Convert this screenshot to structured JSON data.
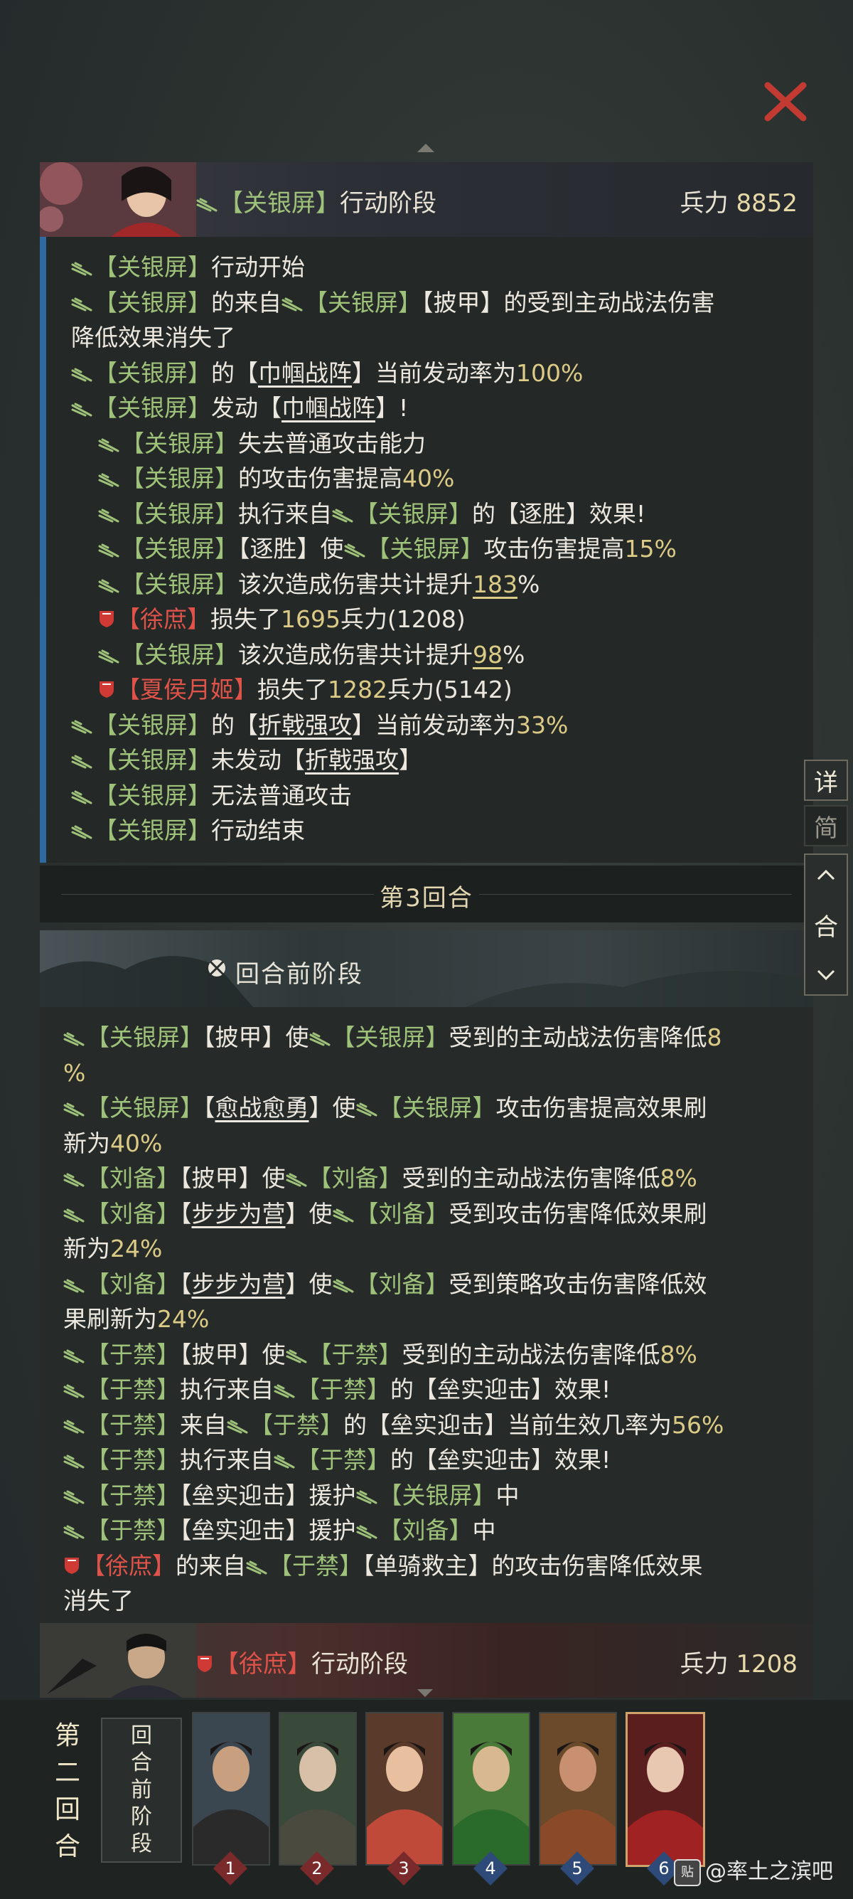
{
  "colors": {
    "name_green": "#9fc27a",
    "name_red": "#e0534a",
    "highlight": "#dccb86",
    "log_bar_blue": "#2c6aa0",
    "close_red": "#c23a32"
  },
  "icons": {
    "ally": "green-slash-icon",
    "enemy": "red-shield-icon"
  },
  "action_header": {
    "name": "关银屏",
    "phase": "行动阶段",
    "troops_label": "兵力",
    "troops_value": "8852"
  },
  "round_separator": "第3回合",
  "pre_round_banner": "回合前阶段",
  "bottom_header": {
    "name": "徐庶",
    "phase": "行动阶段",
    "troops_label": "兵力",
    "troops_value": "1208"
  },
  "side_panel": {
    "detail": "详",
    "simple": "简",
    "round": "合"
  },
  "round_label": [
    "第",
    "二",
    "回",
    "合"
  ],
  "pre_phase_card": [
    "回",
    "合",
    "前",
    "阶",
    "段"
  ],
  "heroes": [
    {
      "number": "1",
      "team": "enemy"
    },
    {
      "number": "2",
      "team": "enemy"
    },
    {
      "number": "3",
      "team": "enemy"
    },
    {
      "number": "4",
      "team": "ally"
    },
    {
      "number": "5",
      "team": "ally"
    },
    {
      "number": "6",
      "team": "ally"
    }
  ],
  "watermark": "@率土之滨吧",
  "watermark_badge": "贴",
  "log1": [
    {
      "indent": 0,
      "segs": [
        {
          "t": "ally"
        },
        {
          "n": "关银屏"
        },
        {
          "x": "行动开始"
        }
      ]
    },
    {
      "indent": 0,
      "segs": [
        {
          "t": "ally"
        },
        {
          "n": "关银屏"
        },
        {
          "x": "的来自"
        },
        {
          "t": "ally"
        },
        {
          "n": "关银屏"
        },
        {
          "x": "【披甲】的受到主动战法伤害"
        }
      ]
    },
    {
      "indent": 0,
      "segs": [
        {
          "x": "降低效果消失了"
        }
      ]
    },
    {
      "indent": 0,
      "segs": [
        {
          "t": "ally"
        },
        {
          "n": "关银屏"
        },
        {
          "x": "的【"
        },
        {
          "s": "巾帼战阵"
        },
        {
          "x": "】当前发动率为"
        },
        {
          "h": "100%"
        }
      ]
    },
    {
      "indent": 0,
      "segs": [
        {
          "t": "ally"
        },
        {
          "n": "关银屏"
        },
        {
          "x": "发动【"
        },
        {
          "s": "巾帼战阵"
        },
        {
          "x": "】!"
        }
      ]
    },
    {
      "indent": 1,
      "segs": [
        {
          "t": "ally"
        },
        {
          "n": "关银屏"
        },
        {
          "x": "失去普通攻击能力"
        }
      ]
    },
    {
      "indent": 1,
      "segs": [
        {
          "t": "ally"
        },
        {
          "n": "关银屏"
        },
        {
          "x": "的攻击伤害提高"
        },
        {
          "h": "40%"
        }
      ]
    },
    {
      "indent": 1,
      "segs": [
        {
          "t": "ally"
        },
        {
          "n": "关银屏"
        },
        {
          "x": "执行来自"
        },
        {
          "t": "ally"
        },
        {
          "n": "关银屏"
        },
        {
          "x": "的【逐胜】效果!"
        }
      ]
    },
    {
      "indent": 1,
      "segs": [
        {
          "t": "ally"
        },
        {
          "n": "关银屏"
        },
        {
          "x": "【逐胜】使"
        },
        {
          "t": "ally"
        },
        {
          "n": "关银屏"
        },
        {
          "x": "攻击伤害提高"
        },
        {
          "h": "15%"
        }
      ]
    },
    {
      "indent": 1,
      "segs": [
        {
          "t": "ally"
        },
        {
          "n": "关银屏"
        },
        {
          "x": "该次造成伤害共计提升"
        },
        {
          "hs": "183"
        },
        {
          "x": "%"
        }
      ]
    },
    {
      "indent": 1,
      "segs": [
        {
          "t": "enemy"
        },
        {
          "r": "徐庶"
        },
        {
          "x": "损失了"
        },
        {
          "h": "1695"
        },
        {
          "x": "兵力(1208)"
        }
      ]
    },
    {
      "indent": 1,
      "segs": [
        {
          "t": "ally"
        },
        {
          "n": "关银屏"
        },
        {
          "x": "该次造成伤害共计提升"
        },
        {
          "hs": "98"
        },
        {
          "x": "%"
        }
      ]
    },
    {
      "indent": 1,
      "segs": [
        {
          "t": "enemy"
        },
        {
          "r": "夏侯月姬"
        },
        {
          "x": "损失了"
        },
        {
          "h": "1282"
        },
        {
          "x": "兵力(5142)"
        }
      ]
    },
    {
      "indent": 0,
      "segs": [
        {
          "t": "ally"
        },
        {
          "n": "关银屏"
        },
        {
          "x": "的【"
        },
        {
          "s": "折戟强攻"
        },
        {
          "x": "】当前发动率为"
        },
        {
          "h": "33%"
        }
      ]
    },
    {
      "indent": 0,
      "segs": [
        {
          "t": "ally"
        },
        {
          "n": "关银屏"
        },
        {
          "x": "未发动【"
        },
        {
          "s": "折戟强攻"
        },
        {
          "x": "】"
        }
      ]
    },
    {
      "indent": 0,
      "segs": [
        {
          "t": "ally"
        },
        {
          "n": "关银屏"
        },
        {
          "x": "无法普通攻击"
        }
      ]
    },
    {
      "indent": 0,
      "segs": [
        {
          "t": "ally"
        },
        {
          "n": "关银屏"
        },
        {
          "x": "行动结束"
        }
      ]
    }
  ],
  "log2": [
    {
      "indent": 0,
      "segs": [
        {
          "t": "ally"
        },
        {
          "n": "关银屏"
        },
        {
          "x": "【披甲】使"
        },
        {
          "t": "ally"
        },
        {
          "n": "关银屏"
        },
        {
          "x": "受到的主动战法伤害降低"
        },
        {
          "h": "8"
        }
      ]
    },
    {
      "indent": 0,
      "segs": [
        {
          "h": "%"
        }
      ]
    },
    {
      "indent": 0,
      "segs": [
        {
          "t": "ally"
        },
        {
          "n": "关银屏"
        },
        {
          "x": "【"
        },
        {
          "s": "愈战愈勇"
        },
        {
          "x": "】使"
        },
        {
          "t": "ally"
        },
        {
          "n": "关银屏"
        },
        {
          "x": "攻击伤害提高效果刷"
        }
      ]
    },
    {
      "indent": 0,
      "segs": [
        {
          "x": "新为"
        },
        {
          "h": "40%"
        }
      ]
    },
    {
      "indent": 0,
      "segs": [
        {
          "t": "ally"
        },
        {
          "n": "刘备"
        },
        {
          "x": "【披甲】使"
        },
        {
          "t": "ally"
        },
        {
          "n": "刘备"
        },
        {
          "x": "受到的主动战法伤害降低"
        },
        {
          "h": "8%"
        }
      ]
    },
    {
      "indent": 0,
      "segs": [
        {
          "t": "ally"
        },
        {
          "n": "刘备"
        },
        {
          "x": "【"
        },
        {
          "s": "步步为营"
        },
        {
          "x": "】使"
        },
        {
          "t": "ally"
        },
        {
          "n": "刘备"
        },
        {
          "x": "受到攻击伤害降低效果刷"
        }
      ]
    },
    {
      "indent": 0,
      "segs": [
        {
          "x": "新为"
        },
        {
          "h": "24%"
        }
      ]
    },
    {
      "indent": 0,
      "segs": [
        {
          "t": "ally"
        },
        {
          "n": "刘备"
        },
        {
          "x": "【"
        },
        {
          "s": "步步为营"
        },
        {
          "x": "】使"
        },
        {
          "t": "ally"
        },
        {
          "n": "刘备"
        },
        {
          "x": "受到策略攻击伤害降低效"
        }
      ]
    },
    {
      "indent": 0,
      "segs": [
        {
          "x": "果刷新为"
        },
        {
          "h": "24%"
        }
      ]
    },
    {
      "indent": 0,
      "segs": [
        {
          "t": "ally"
        },
        {
          "n": "于禁"
        },
        {
          "x": "【披甲】使"
        },
        {
          "t": "ally"
        },
        {
          "n": "于禁"
        },
        {
          "x": "受到的主动战法伤害降低"
        },
        {
          "h": "8%"
        }
      ]
    },
    {
      "indent": 0,
      "segs": [
        {
          "t": "ally"
        },
        {
          "n": "于禁"
        },
        {
          "x": "执行来自"
        },
        {
          "t": "ally"
        },
        {
          "n": "于禁"
        },
        {
          "x": "的【垒实迎击】效果!"
        }
      ]
    },
    {
      "indent": 0,
      "segs": [
        {
          "t": "ally"
        },
        {
          "n": "于禁"
        },
        {
          "x": "来自"
        },
        {
          "t": "ally"
        },
        {
          "n": "于禁"
        },
        {
          "x": "的【垒实迎击】当前生效几率为"
        },
        {
          "h": "56%"
        }
      ]
    },
    {
      "indent": 0,
      "segs": [
        {
          "t": "ally"
        },
        {
          "n": "于禁"
        },
        {
          "x": "执行来自"
        },
        {
          "t": "ally"
        },
        {
          "n": "于禁"
        },
        {
          "x": "的【垒实迎击】效果!"
        }
      ]
    },
    {
      "indent": 0,
      "segs": [
        {
          "t": "ally"
        },
        {
          "n": "于禁"
        },
        {
          "x": "【垒实迎击】援护"
        },
        {
          "t": "ally"
        },
        {
          "n": "关银屏"
        },
        {
          "x": "中"
        }
      ]
    },
    {
      "indent": 0,
      "segs": [
        {
          "t": "ally"
        },
        {
          "n": "于禁"
        },
        {
          "x": "【垒实迎击】援护"
        },
        {
          "t": "ally"
        },
        {
          "n": "刘备"
        },
        {
          "x": "中"
        }
      ]
    },
    {
      "indent": 0,
      "segs": [
        {
          "t": "enemy"
        },
        {
          "r": "徐庶"
        },
        {
          "x": "的来自"
        },
        {
          "t": "ally"
        },
        {
          "n": "于禁"
        },
        {
          "x": "【单骑救主】的攻击伤害降低效果"
        }
      ]
    },
    {
      "indent": 0,
      "segs": [
        {
          "x": "消失了"
        }
      ]
    }
  ]
}
